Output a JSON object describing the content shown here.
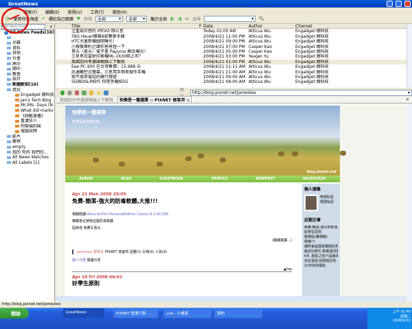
{
  "window": {
    "title": "GreatNews"
  },
  "menu": [
    "檔案(F)",
    "編輯(E)",
    "檢視(V)",
    "工具(T)",
    "幫助(H)"
  ],
  "toolbar": {
    "update_all": "更新所有頻道",
    "mark_read": "標記為已閱讀",
    "filter_label": "新聞",
    "filter1": "全部",
    "filter2": "全部",
    "show_all": "顯示全部",
    "search_label": "搜尋",
    "search_value": ""
  },
  "left": {
    "search_placeholder": "Add News Feed",
    "close": "×",
    "tree": [
      {
        "label": "All News Feeds(16)",
        "bold": true
      },
      {
        "label": ""
      },
      {
        "label": "光碟"
      },
      {
        "label": "資料"
      },
      {
        "label": "其他"
      },
      {
        "label": "社會"
      },
      {
        "label": "高中"
      },
      {
        "label": "國中"
      },
      {
        "label": "教會"
      },
      {
        "label": "設計"
      },
      {
        "label": "新聞新知(16)",
        "bold": true
      },
      {
        "label": "資訊"
      },
      {
        "label": "Engadget 癮科技",
        "sub": true
      },
      {
        "label": "Jan's Tech Blog",
        "sub": true
      },
      {
        "label": "Mr./Ms. Days (N",
        "sub": true
      },
      {
        "label": "What did marko",
        "sub": true
      },
      {
        "label": "《純敏速播》",
        "sub": true
      },
      {
        "label": "重灌狂人",
        "sub": true
      },
      {
        "label": "阿榮福利味",
        "sub": true
      },
      {
        "label": "電腦玩物",
        "sub": true
      },
      {
        "label": "影片"
      },
      {
        "label": "龐裡"
      },
      {
        "label": "empty"
      },
      {
        "label": "我的 你的 我們的..."
      },
      {
        "label": "All News Watches"
      },
      {
        "label": "All Labels [1]"
      }
    ]
  },
  "list": {
    "headers": [
      "Title",
      "F",
      "Date",
      "Author",
      "Channel"
    ],
    "rows": [
      [
        "注重設計感的 IPEVO 辦公室",
        "Today 01:00 AM",
        "Atticus Wu",
        "Engadget 癮科技"
      ],
      [
        "TAG Heuer爾幕8款賽車手錶",
        "2008/4/21 11:00 PM",
        "Atticus Wu",
        "Engadget 癮科技"
      ],
      [
        "HTC大量新機圖照曝光！",
        "2008/4/21 09:00 PM",
        "Atticus Wu",
        "Engadget 癮科技"
      ],
      [
        "小猴猴專利之讓你爸爸扭一下",
        "2008/4/21 07:00 PM",
        "Casper Kao",
        "Engadget 癮科技"
      ],
      [
        "買元（美元）電子書 Papyrus 概念曝光！",
        "2008/4/21 05:00 PM",
        "Casper Kao",
        "Engadget 癮科技"
      ],
      [
        "三星黑白雷射印表機ML-1630將上市？",
        "2008/4/21 03:00 PM",
        "Yeager Yu",
        "Engadget 癮科技"
      ],
      [
        "美國加州考慮課徵線上下載稅",
        "2008/4/21 01:00 PM",
        "Atticus Wu",
        "Engadget 癮科技"
      ],
      [
        "Eee PC 900 在台灣售價：15,988 元",
        "2008/4/21 11:11 AM",
        "Atticus Wu",
        "Engadget 癮科技"
      ],
      [
        "訊通觸控式螢幕，三星用手勢來操作手機",
        "2008/4/21 11:00 AM",
        "Atticus Wu",
        "Engadget 癮科技"
      ],
      [
        "接不接來電話的硬行撥號",
        "2008/4/21 09:00 AM",
        "Atticus Wu",
        "Engadget 癮科技"
      ],
      [
        "5G與DSLR拍作 你用手機拍5G",
        "2008/4/21 08:00 AM",
        "Atticus Wu",
        "Engadget 癮科技"
      ]
    ],
    "selected": 6
  },
  "browser": {
    "address_label": "網址",
    "url": "http://blog.pixnet.net/jameslee",
    "tabs": [
      "美國加州考慮課徵線上下載稅",
      "快樂是一種選擇 :: PIXNET 痞客邦 ::"
    ]
  },
  "blog": {
    "title": "快樂是一種選擇",
    "subtitle": "快樂是要選擇的喔",
    "watermark": "blog.pixnet.net",
    "nav": [
      "ALBUM",
      "BLOG",
      "GUESTBOOK",
      "PROFILE",
      "NEWPOST",
      "BACKSTAGE"
    ],
    "post": {
      "date": "Apr 21 Mon 2008 20:05",
      "title": "免費-簡潔-強大的防毒軟體,大推!!!",
      "related_label": "相關閱讀:",
      "related_link": "Avira AntiVir PersonalEdition Classic 8.1.00.295",
      "line2": "推薦各位使用這套防毒軟體",
      "line3": "因為他 免費又強大",
      "more": "(繼續閱讀...)",
      "author": "jameslee 發表在",
      "meta": "PIXNET 痞客邦 迴響(1) 引用(0) 人氣(9)",
      "category_label": "個人分類",
      "category": "閱讀分享",
      "top": "▲top"
    },
    "post2": {
      "date": "Apr 18 Fri 2008 06:03",
      "title": "好學生原則"
    },
    "sidebar": {
      "avatar_title": "個人頭像",
      "links": [
        "申請好友",
        "傳送私訊"
      ],
      "recent_title": "近期文章",
      "recent": [
        "免費-簡潔-強大的防毒軟體,大推!!!",
        "好學生原則",
        "我相信(賽德鍋)",
        "號稱!!!",
        "總財官是個有趨勢的男人!!",
        "最近比較忙,對者還活著!!",
        "hi5 ,朋友之約?!是病毒吧...",
        "流言蜚語-枕頭與羽毛",
        "2/25好的開始"
      ]
    }
  },
  "status": {
    "text": "http://blog.pixnet.net/jameslee"
  },
  "taskbar": {
    "start": "開始",
    "tasks": [
      "GreatNews",
      "PIXNET 管理介面 - ...",
      "uml - 小畫家",
      "我的"
    ],
    "time": "上午 01:40",
    "day": "星期二",
    "date": "2008/4/22"
  }
}
